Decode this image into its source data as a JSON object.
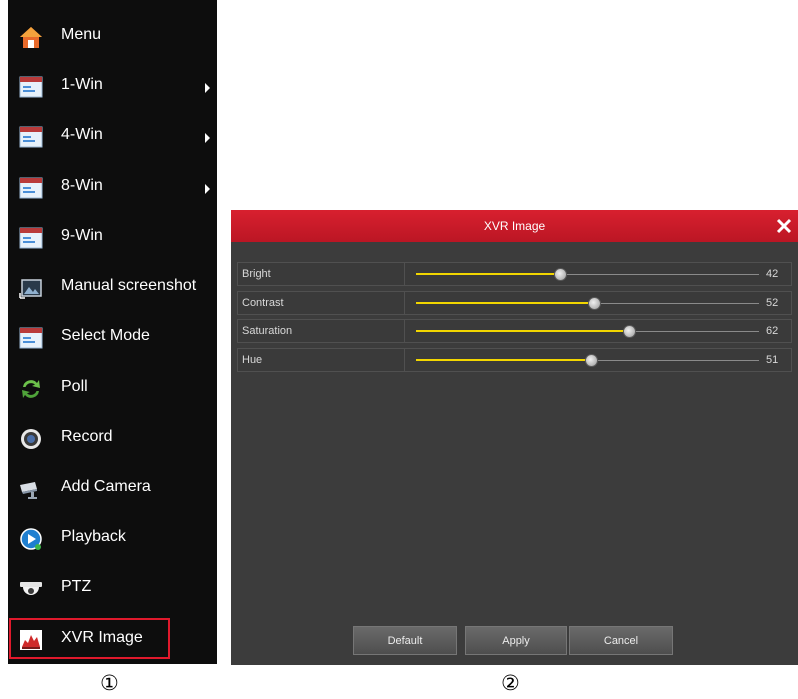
{
  "menu": {
    "items": [
      {
        "label": "Menu",
        "icon": "home-icon"
      },
      {
        "label": "1-Win",
        "icon": "window-icon",
        "submenu": true
      },
      {
        "label": "4-Win",
        "icon": "window-icon",
        "submenu": true
      },
      {
        "label": "8-Win",
        "icon": "window-icon",
        "submenu": true
      },
      {
        "label": "9-Win",
        "icon": "window-icon"
      },
      {
        "label": "Manual screenshot",
        "icon": "screenshot-icon"
      },
      {
        "label": "Select Mode",
        "icon": "window-icon"
      },
      {
        "label": "Poll",
        "icon": "refresh-arrows-icon"
      },
      {
        "label": "Record",
        "icon": "record-icon"
      },
      {
        "label": "Add Camera",
        "icon": "camera-icon"
      },
      {
        "label": "Playback",
        "icon": "playback-icon"
      },
      {
        "label": "PTZ",
        "icon": "dome-camera-icon"
      },
      {
        "label": "XVR Image",
        "icon": "image-chart-icon",
        "highlighted": true
      }
    ],
    "highlight_color": "#e0192c"
  },
  "dialog": {
    "title": "XVR Image",
    "sliders": [
      {
        "label": "Bright",
        "value": "42",
        "position": 0.42
      },
      {
        "label": "Contrast",
        "value": "52",
        "position": 0.52
      },
      {
        "label": "Saturation",
        "value": "62",
        "position": 0.62
      },
      {
        "label": "Hue",
        "value": "51",
        "position": 0.51
      }
    ],
    "buttons": {
      "default": "Default",
      "apply": "Apply",
      "cancel": "Cancel"
    },
    "accent_color": "#f2d600",
    "titlebar_color": "#d01c2b"
  },
  "captions": {
    "left": "①",
    "right": "②"
  }
}
